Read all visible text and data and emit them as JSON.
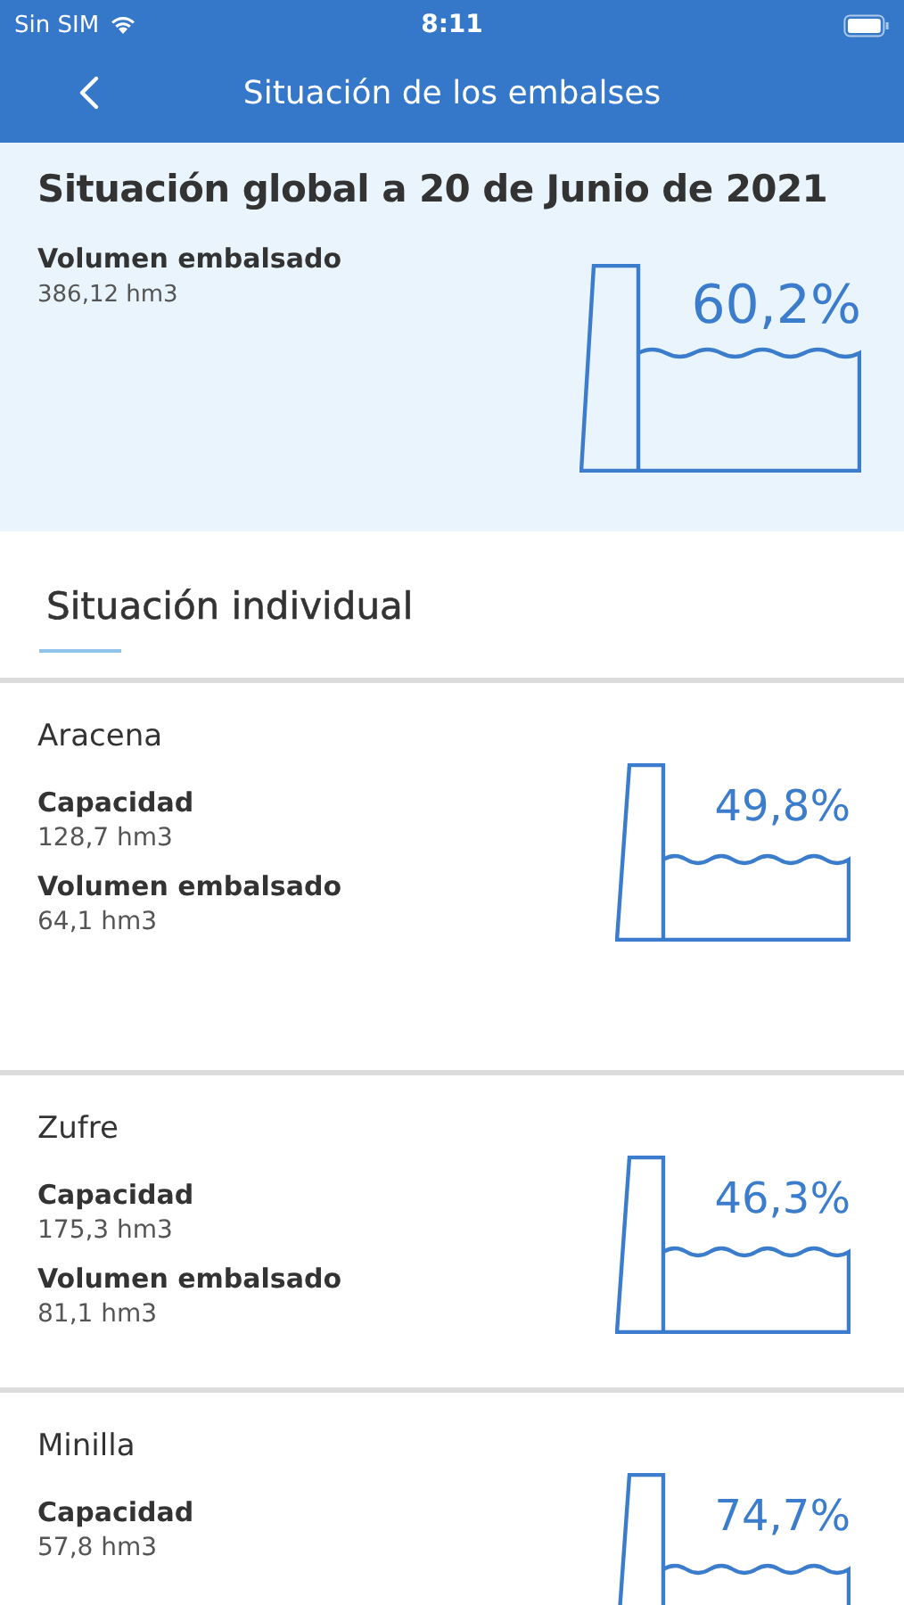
{
  "status_bar": {
    "carrier": "Sin SIM",
    "time": "8:11"
  },
  "nav": {
    "title": "Situación de los embalses"
  },
  "global": {
    "title": "Situación global a 20 de Junio de 2021",
    "volume_label": "Volumen embalsado",
    "volume": "386,12 hm3",
    "percent": "60,2%"
  },
  "section_title": "Situación individual",
  "reservoirs": [
    {
      "name": "Aracena",
      "capacity_label": "Capacidad",
      "capacity": "128,7 hm3",
      "volume_label": "Volumen embalsado",
      "volume": "64,1 hm3",
      "percent": "49,8%"
    },
    {
      "name": "Zufre",
      "capacity_label": "Capacidad",
      "capacity": "175,3 hm3",
      "volume_label": "Volumen embalsado",
      "volume": "81,1 hm3",
      "percent": "46,3%"
    },
    {
      "name": "Minilla",
      "capacity_label": "Capacidad",
      "capacity": "57,8 hm3",
      "percent": "74,7%"
    }
  ]
}
